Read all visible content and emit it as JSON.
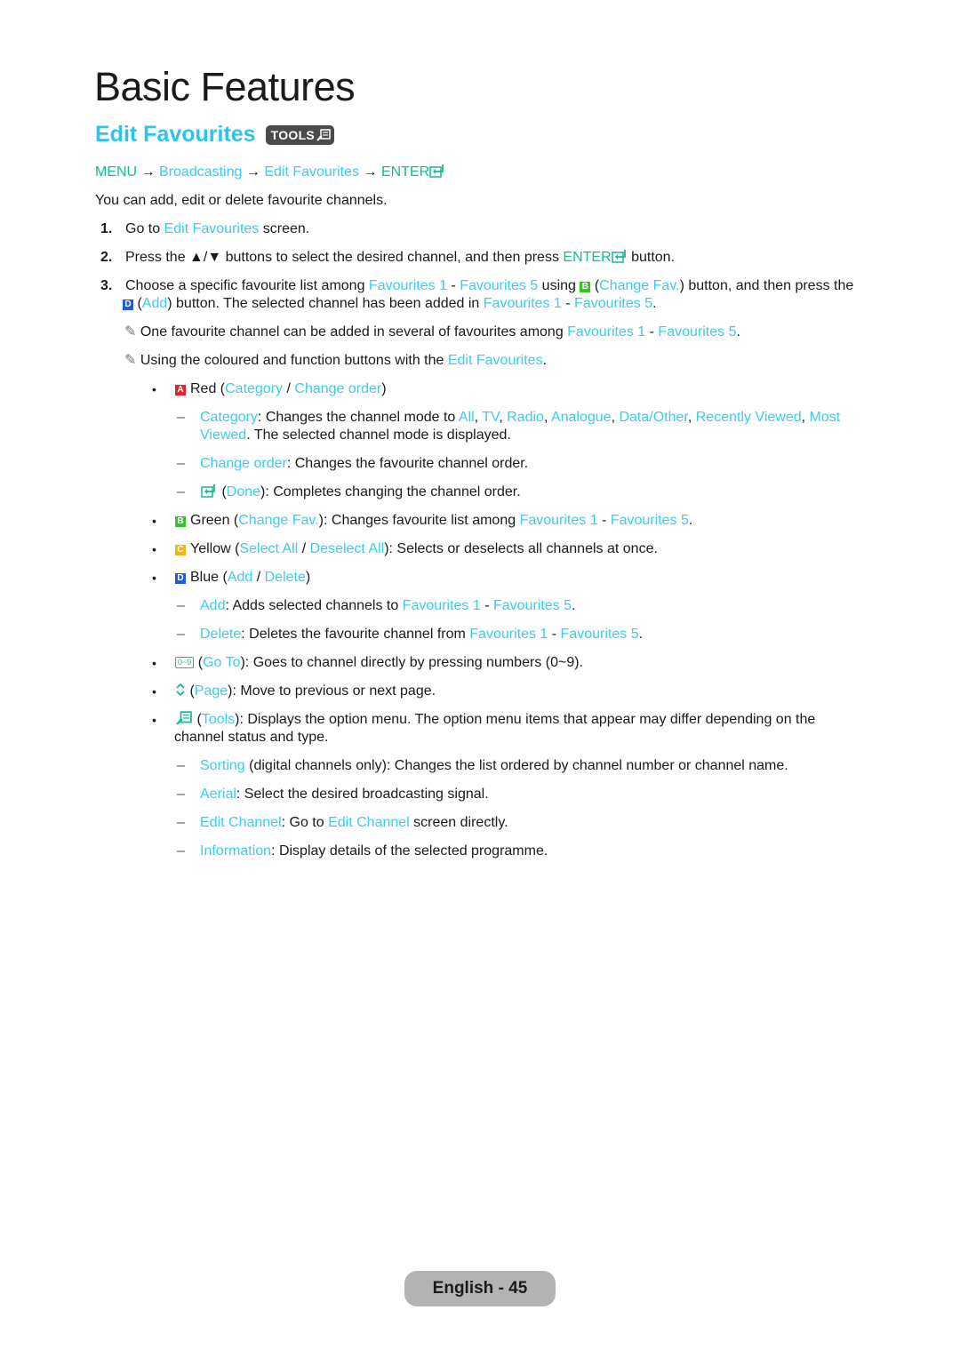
{
  "page_title": "Basic Features",
  "section": {
    "title": "Edit Favourites",
    "badge_label": "TOOLS",
    "badge_icon": "tools-icon"
  },
  "breadcrumb": {
    "menu": "MENU",
    "arrow": "→",
    "broadcasting": "Broadcasting",
    "edit_favourites": "Edit Favourites",
    "enter": "ENTER",
    "enter_icon": "enter-icon"
  },
  "intro": "You can add, edit or delete favourite channels.",
  "steps": [
    {
      "num": "1.",
      "pre": "Go to ",
      "link": "Edit Favourites",
      "post": " screen."
    },
    {
      "num": "2.",
      "pre": "Press the ▲/▼ buttons to select the desired channel, and then press ",
      "tl": "ENTER",
      "post": " button."
    },
    {
      "num": "3.",
      "l1_pre": "Choose a specific favourite list among ",
      "fav1": "Favourites 1",
      "sep": " - ",
      "fav5": "Favourites 5",
      "l1_mid": " using ",
      "btn_b": "B",
      "l1_paren_open": " (",
      "change_fav": "Change Fav.",
      "l1_post": ") button, and then press the",
      "btn_d": "D",
      "l2_paren_open": " (",
      "add": "Add",
      "l2_mid": ") button. The selected channel has been added in ",
      "l2_end": "."
    }
  ],
  "notes": [
    {
      "icon": "✎",
      "pre": " One favourite channel can be added in several of favourites among ",
      "fav1": "Favourites 1",
      "sep": " - ",
      "fav5": "Favourites 5",
      "post": "."
    },
    {
      "icon": "✎",
      "pre": " Using the coloured and function buttons with the ",
      "link": "Edit Favourites",
      "post": "."
    }
  ],
  "bullets": {
    "red": {
      "key": "A",
      "label": "Red (",
      "opt1": "Category",
      "slash": " / ",
      "opt2": "Change order",
      "close": ")"
    },
    "red_sub": [
      {
        "link": "Category",
        "text": ": Changes the channel mode to ",
        "modes": [
          "All",
          "TV",
          "Radio",
          "Analogue",
          "Data/Other",
          "Recently Viewed",
          "Most"
        ],
        "mode_cont": "Viewed",
        "text2": ". The selected channel mode is displayed."
      },
      {
        "link": "Change order",
        "text": ": Changes the favourite channel order."
      },
      {
        "icon": "enter-icon",
        "open": " (",
        "link": "Done",
        "text": "): Completes changing the channel order."
      }
    ],
    "green": {
      "key": "B",
      "label": "Green (",
      "link": "Change Fav.",
      "text": "): Changes favourite list among ",
      "fav1": "Favourites 1",
      "sep": " - ",
      "fav5": "Favourites 5",
      "end": "."
    },
    "yellow": {
      "key": "C",
      "label": "Yellow (",
      "opt1": "Select All",
      "slash": " / ",
      "opt2": "Deselect All",
      "text": "): Selects or deselects all channels at once."
    },
    "blue": {
      "key": "D",
      "label": "Blue (",
      "opt1": "Add",
      "slash": " / ",
      "opt2": "Delete",
      "close": ")"
    },
    "blue_sub": [
      {
        "link": "Add",
        "text": ": Adds selected channels to ",
        "fav1": "Favourites 1",
        "sep": " - ",
        "fav5": "Favourites 5",
        "end": "."
      },
      {
        "link": "Delete",
        "text": ": Deletes the favourite channel from ",
        "fav1": "Favourites 1",
        "sep": " - ",
        "fav5": "Favourites 5",
        "end": "."
      }
    ],
    "goto": {
      "icon_label": "0~9",
      "open": " (",
      "link": "Go To",
      "text": "): Goes to channel directly by pressing numbers (0~9)."
    },
    "page": {
      "open": " (",
      "link": "Page",
      "text": "): Move to previous or next page."
    },
    "tools": {
      "open": " (",
      "link": "Tools",
      "text": "): Displays the option menu. The option menu items that appear may differ depending on the",
      "text2": "channel status and type."
    },
    "tools_sub": [
      {
        "link": "Sorting",
        "text": " (digital channels only): Changes the list ordered by channel number or channel name."
      },
      {
        "link": "Aerial",
        "text": ": Select the desired broadcasting signal."
      },
      {
        "link": "Edit Channel",
        "text": ": Go to ",
        "link2": "Edit Channel",
        "text2": " screen directly."
      },
      {
        "link": "Information",
        "text": ": Display details of the selected programme."
      }
    ]
  },
  "bullet_char": "•",
  "dash_char": "–",
  "footer": {
    "page_label": "English - 45"
  },
  "colors": {
    "link": "#3ccbf0",
    "menu_key": "#17b894",
    "title_accent": "#2dc3f0",
    "red_btn": "#e8202a",
    "green_btn": "#35c424",
    "yellow_btn": "#f5b40e",
    "blue_btn": "#1c5de0",
    "footer_pill": "#b3b3b3"
  }
}
